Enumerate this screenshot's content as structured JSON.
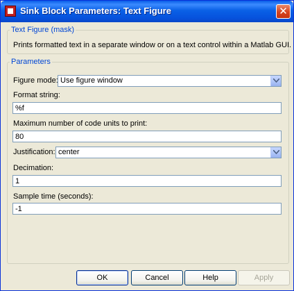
{
  "window": {
    "title": "Sink Block Parameters: Text Figure"
  },
  "mask": {
    "legend": "Text Figure (mask)",
    "description": "Prints formatted text in a separate window or on a text control within a Matlab GUI."
  },
  "parameters": {
    "legend": "Parameters",
    "figure_mode": {
      "label": "Figure mode:",
      "value": "Use figure window"
    },
    "format_string": {
      "label": "Format string:",
      "value": "%f"
    },
    "max_code_units": {
      "label": "Maximum number of code units to print:",
      "value": "80"
    },
    "justification": {
      "label": "Justification:",
      "value": "center"
    },
    "decimation": {
      "label": "Decimation:",
      "value": "1"
    },
    "sample_time": {
      "label": "Sample time (seconds):",
      "value": "-1"
    }
  },
  "buttons": {
    "ok": "OK",
    "cancel": "Cancel",
    "help": "Help",
    "apply": "Apply"
  },
  "colors": {
    "titlebar": "#0a5de8",
    "legend": "#0046d5",
    "dialog_bg": "#ece9d8",
    "close": "#d6431f"
  },
  "icons": {
    "app": "simulink-block-icon",
    "close": "close-icon",
    "dropdown": "chevron-down-icon"
  }
}
